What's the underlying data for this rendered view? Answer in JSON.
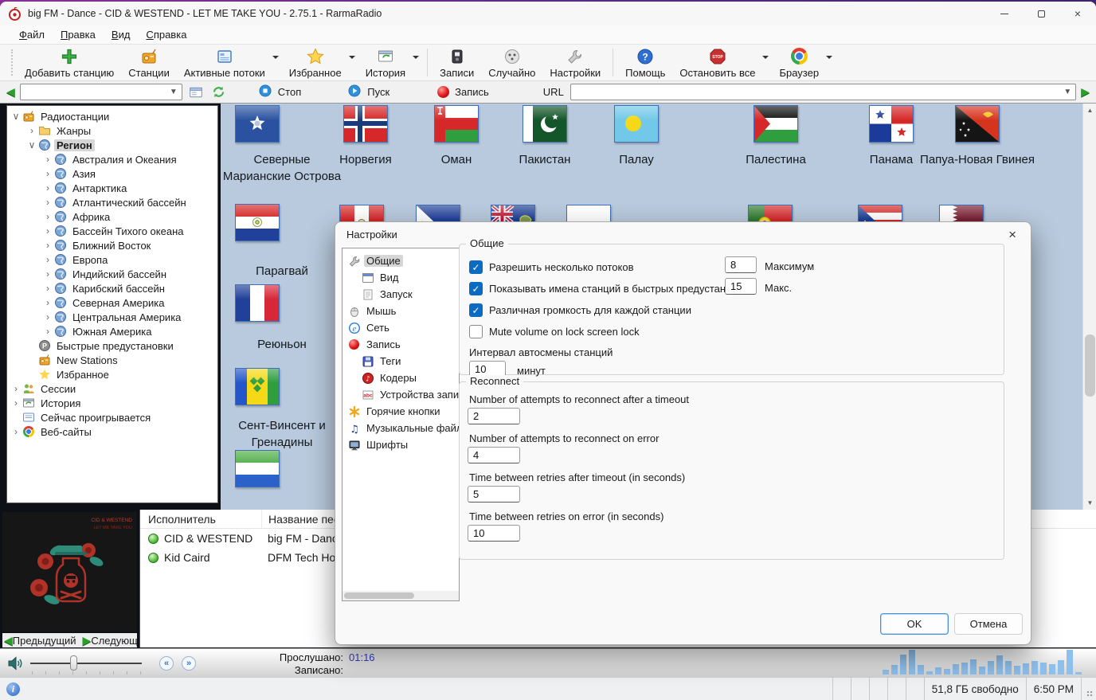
{
  "window": {
    "title": "big FM - Dance - CID & WESTEND - LET ME TAKE YOU - 2.75.1 - RarmaRadio",
    "controls": [
      "minimize",
      "maximize",
      "close"
    ]
  },
  "menu": {
    "items": [
      "Файл",
      "Правка",
      "Вид",
      "Справка"
    ]
  },
  "toolbar": {
    "buttons": [
      {
        "label": "Добавить станцию",
        "icon": "add-station-icon",
        "dropdown": false,
        "sep_after": false
      },
      {
        "label": "Станции",
        "icon": "stations-icon",
        "dropdown": false,
        "sep_after": false
      },
      {
        "label": "Активные потоки",
        "icon": "active-streams-icon",
        "dropdown": true,
        "sep_after": false
      },
      {
        "label": "Избранное",
        "icon": "favorites-icon",
        "dropdown": true,
        "sep_after": false
      },
      {
        "label": "История",
        "icon": "history-icon",
        "dropdown": true,
        "sep_after": true
      },
      {
        "label": "Записи",
        "icon": "records-icon",
        "dropdown": false,
        "sep_after": false
      },
      {
        "label": "Случайно",
        "icon": "random-icon",
        "dropdown": false,
        "sep_after": false
      },
      {
        "label": "Настройки",
        "icon": "settings-icon",
        "dropdown": false,
        "sep_after": true
      },
      {
        "label": "Помощь",
        "icon": "help-icon",
        "dropdown": false,
        "sep_after": false
      },
      {
        "label": "Остановить все",
        "icon": "stop-all-icon",
        "dropdown": true,
        "sep_after": false
      },
      {
        "label": "Браузер",
        "icon": "browser-icon",
        "dropdown": true,
        "sep_after": false
      }
    ]
  },
  "toolbar2": {
    "search_value": "",
    "stop_label": "Стоп",
    "play_label": "Пуск",
    "record_label": "Запись",
    "url_label": "URL",
    "url_value": ""
  },
  "sidebar": {
    "items": [
      {
        "label": "Радиостанции",
        "icon": "radio",
        "depth": 0,
        "exp": "open",
        "selected": false
      },
      {
        "label": "Жанры",
        "icon": "folder",
        "depth": 1,
        "exp": "closed",
        "selected": false
      },
      {
        "label": "Регион",
        "icon": "globe",
        "depth": 1,
        "exp": "open",
        "selected": true
      },
      {
        "label": "Австралия и Океания",
        "icon": "globe",
        "depth": 2,
        "exp": "closed",
        "selected": false
      },
      {
        "label": "Азия",
        "icon": "globe",
        "depth": 2,
        "exp": "closed",
        "selected": false
      },
      {
        "label": "Антарктика",
        "icon": "globe",
        "depth": 2,
        "exp": "closed",
        "selected": false
      },
      {
        "label": "Атлантический бассейн",
        "icon": "globe",
        "depth": 2,
        "exp": "closed",
        "selected": false
      },
      {
        "label": "Африка",
        "icon": "globe",
        "depth": 2,
        "exp": "closed",
        "selected": false
      },
      {
        "label": "Бассейн Тихого океана",
        "icon": "globe",
        "depth": 2,
        "exp": "closed",
        "selected": false
      },
      {
        "label": "Ближний Восток",
        "icon": "globe",
        "depth": 2,
        "exp": "closed",
        "selected": false
      },
      {
        "label": "Европа",
        "icon": "globe",
        "depth": 2,
        "exp": "closed",
        "selected": false
      },
      {
        "label": "Индийский бассейн",
        "icon": "globe",
        "depth": 2,
        "exp": "closed",
        "selected": false
      },
      {
        "label": "Карибский бассейн",
        "icon": "globe",
        "depth": 2,
        "exp": "closed",
        "selected": false
      },
      {
        "label": "Северная Америка",
        "icon": "globe",
        "depth": 2,
        "exp": "closed",
        "selected": false
      },
      {
        "label": "Центральная Америка",
        "icon": "globe",
        "depth": 2,
        "exp": "closed",
        "selected": false
      },
      {
        "label": "Южная Америка",
        "icon": "globe",
        "depth": 2,
        "exp": "closed",
        "selected": false
      },
      {
        "label": "Быстрые предустановки",
        "icon": "preset",
        "depth": 1,
        "exp": "none",
        "selected": false
      },
      {
        "label": "New Stations",
        "icon": "radio",
        "depth": 1,
        "exp": "none",
        "selected": false
      },
      {
        "label": "Избранное",
        "icon": "star",
        "depth": 1,
        "exp": "none",
        "selected": false
      },
      {
        "label": "Сессии",
        "icon": "users",
        "depth": 0,
        "exp": "closed",
        "selected": false
      },
      {
        "label": "История",
        "icon": "history",
        "depth": 0,
        "exp": "closed",
        "selected": false
      },
      {
        "label": "Сейчас проигрывается",
        "icon": "nowplay",
        "depth": 0,
        "exp": "none",
        "selected": false
      },
      {
        "label": "Веб-сайты",
        "icon": "chrome",
        "depth": 0,
        "exp": "closed",
        "selected": false
      }
    ]
  },
  "flags": {
    "row1": [
      {
        "label": "Северные Марианские Острова",
        "code": "mp"
      },
      {
        "label": "Норвегия",
        "code": "no"
      },
      {
        "label": "Оман",
        "code": "om"
      },
      {
        "label": "Пакистан",
        "code": "pk"
      },
      {
        "label": "Палау",
        "code": "pw"
      },
      {
        "label": "Палестина",
        "code": "ps"
      },
      {
        "label": "Панама",
        "code": "pa"
      },
      {
        "label": "Папуа-Новая Гвинея",
        "code": "pg"
      }
    ],
    "left_column": [
      {
        "label": "Парагвай",
        "code": "py"
      },
      {
        "label": "Реюньон",
        "code": "re"
      },
      {
        "label": "Сент-Винсент и Гренадины",
        "code": "vc"
      },
      {
        "label": "",
        "code": "sl"
      }
    ],
    "row2_partial": [
      {
        "label": "",
        "code": "pe"
      },
      {
        "label": "",
        "code": "ph"
      },
      {
        "label": "",
        "code": "pn"
      },
      {
        "label": "",
        "code": "pl"
      },
      {
        "label": "",
        "code": "pt"
      },
      {
        "label": "",
        "code": "pr"
      },
      {
        "label": "",
        "code": "qa"
      }
    ]
  },
  "dialog": {
    "title": "Настройки",
    "tree": [
      {
        "label": "Общие",
        "icon": "wrench",
        "depth": 0,
        "selected": true
      },
      {
        "label": "Вид",
        "icon": "window",
        "depth": 1,
        "selected": false
      },
      {
        "label": "Запуск",
        "icon": "doc",
        "depth": 1,
        "selected": false
      },
      {
        "label": "Мышь",
        "icon": "mouse",
        "depth": 0,
        "selected": false
      },
      {
        "label": "Сеть",
        "icon": "ie",
        "depth": 0,
        "selected": false
      },
      {
        "label": "Запись",
        "icon": "redball",
        "depth": 0,
        "selected": false
      },
      {
        "label": "Теги",
        "icon": "floppy",
        "depth": 1,
        "selected": false
      },
      {
        "label": "Кодеры",
        "icon": "notered",
        "depth": 1,
        "selected": false
      },
      {
        "label": "Устройства записи",
        "icon": "abc",
        "depth": 1,
        "selected": false
      },
      {
        "label": "Горячие кнопки",
        "icon": "asterisk",
        "depth": 0,
        "selected": false
      },
      {
        "label": "Музыкальные файлы",
        "icon": "note",
        "depth": 0,
        "selected": false
      },
      {
        "label": "Шрифты",
        "icon": "monitor",
        "depth": 0,
        "selected": false
      }
    ],
    "general": {
      "title": "Общие",
      "checkboxes": [
        {
          "label": "Разрешить несколько потоков",
          "checked": true,
          "value": "8",
          "suffix": "Максимум"
        },
        {
          "label": "Показывать имена станций в быстрых предустановка",
          "checked": true,
          "value": "15",
          "suffix": "Макс."
        },
        {
          "label": "Различная громкость для каждой станции",
          "checked": true
        },
        {
          "label": "Mute volume on lock screen lock",
          "checked": false
        }
      ],
      "interval_label": "Интервал автосмены станций",
      "interval_value": "10",
      "interval_suffix": "минут"
    },
    "reconnect": {
      "title": "Reconnect",
      "fields": [
        {
          "label": "Number of attempts to reconnect after a timeout",
          "value": "2"
        },
        {
          "label": "Number of attempts to reconnect on error",
          "value": "4"
        },
        {
          "label": "Time between retries after timeout (in seconds)",
          "value": "5"
        },
        {
          "label": "Time between retries on error (in seconds)",
          "value": "10"
        }
      ]
    },
    "ok_label": "OK",
    "cancel_label": "Отмена"
  },
  "player": {
    "columns": {
      "artist": "Исполнитель",
      "song": "Название песни"
    },
    "rows": [
      {
        "artist": "CID & WESTEND",
        "song": "big FM - Dance"
      },
      {
        "artist": "Kid Caird",
        "song": "DFM Tech House"
      }
    ],
    "prev_label": "Предыдущий",
    "next_label": "Следующий",
    "listened_label": "Прослушано:",
    "listened_value": "01:16",
    "recorded_label": "Записано:",
    "recorded_value": ""
  },
  "album_art": {
    "line1": "CID & WESTEND",
    "line2": "LET ME TAKE YOU"
  },
  "spectrum": {
    "color": "#8fc0ec",
    "bars": [
      6,
      12,
      25,
      31,
      12,
      4,
      9,
      7,
      13,
      15,
      19,
      10,
      17,
      24,
      17,
      11,
      14,
      17,
      15,
      13,
      18,
      31,
      3
    ]
  },
  "status": {
    "free_space": "51,8 ГБ свободно",
    "time": "6:50 PM"
  },
  "colors": {
    "accent": "#0b6bc2",
    "flags_bg": "#b9cade",
    "value_blue": "#3c3ccf",
    "selection": "#d6d6d6"
  }
}
